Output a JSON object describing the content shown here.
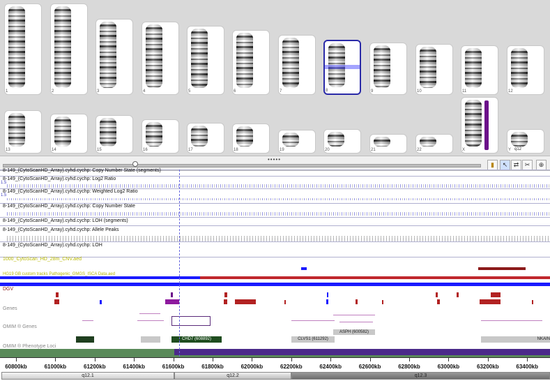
{
  "karyogram": {
    "row1": [
      {
        "num": "1"
      },
      {
        "num": "2"
      },
      {
        "num": "3"
      },
      {
        "num": "4"
      },
      {
        "num": "5"
      },
      {
        "num": "6"
      },
      {
        "num": "7"
      },
      {
        "num": "8"
      },
      {
        "num": "9"
      },
      {
        "num": "10"
      },
      {
        "num": "11"
      },
      {
        "num": "12"
      }
    ],
    "row2": [
      {
        "num": "13"
      },
      {
        "num": "14"
      },
      {
        "num": "15"
      },
      {
        "num": "16"
      },
      {
        "num": "17"
      },
      {
        "num": "18"
      },
      {
        "num": "19"
      },
      {
        "num": "20"
      },
      {
        "num": "21"
      },
      {
        "num": "22"
      },
      {
        "num": "X"
      },
      {
        "num": "Y"
      }
    ],
    "y_label": "q12",
    "selected": "8"
  },
  "toolbar": {
    "grip": "•••••"
  },
  "tracks": [
    {
      "label": "8-149_(CytoScanHD_Array).cyhd.cychp: Copy Number State (segments)"
    },
    {
      "label": "8-149_(CytoScanHD_Array).cyhd.cychp: Log2 Ratio",
      "scale": "1.5"
    },
    {
      "label": "8-149_(CytoScanHD_Array).cyhd.cychp: Weighted Log2 Ratio",
      "scale": "1.5"
    },
    {
      "label": "8-149_(CytoScanHD_Array).cyhd.cychp: Copy Number State"
    },
    {
      "label": "8-149_(CytoScanHD_Array).cyhd.cychp: LOH (segments)"
    },
    {
      "label": "8-149_(CytoScanHD_Array).cyhd.cychp: Allele Peaks"
    },
    {
      "label": "8-149_(CytoScanHD_Array).cyhd.cychp: LOH"
    }
  ],
  "annotations": {
    "cnv_set": "1000_CytoScan_HD_28m_CNV.aed",
    "genes_db": "HG19 GB custom tracks Pathogenic_GMGS_ISCA Data.aed",
    "dgv": "DGV",
    "genes": "Genes",
    "omim_genes": "OMIM ® Genes",
    "omim_pheno": "OMIM ® Phenotype Loci",
    "omim_boxes": [
      {
        "text": "CHD7 (608892)"
      },
      {
        "text": "CLVS1 (611292)"
      },
      {
        "text": "ASPH (600582)"
      },
      {
        "text": "NKAIN"
      }
    ]
  },
  "axis": {
    "ticks": [
      "60800kb",
      "61000kb",
      "61200kb",
      "61400kb",
      "61600kb",
      "61800kb",
      "62000kb",
      "62200kb",
      "62400kb",
      "62600kb",
      "62800kb",
      "63000kb",
      "63200kb",
      "63400kb"
    ]
  },
  "bands": [
    {
      "text": "q12.1"
    },
    {
      "text": "q12.2"
    },
    {
      "text": "q12.3"
    }
  ],
  "colors": {
    "selection": "#2a2aa8",
    "dgv_red": "#b22222",
    "omim_green": "#1f4d1f",
    "pheno_purple": "#4b2a8a",
    "cnv_blue": "#1a1aff"
  }
}
